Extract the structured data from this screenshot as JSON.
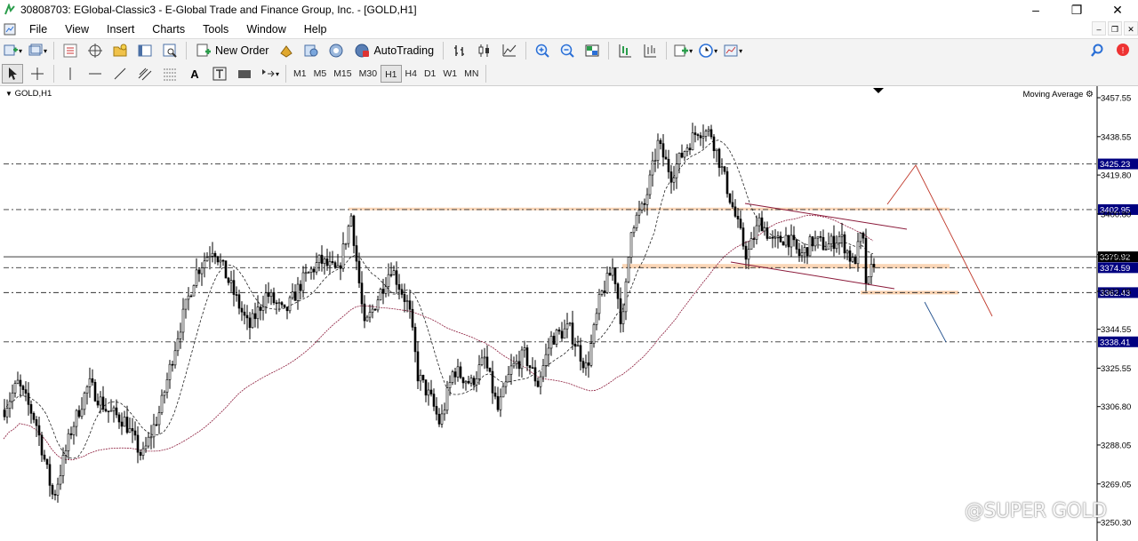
{
  "window": {
    "title": "30808703: EGlobal-Classic3 - E-Global Trade and Finance Group, Inc. - [GOLD,H1]"
  },
  "menu": [
    "File",
    "View",
    "Insert",
    "Charts",
    "Tools",
    "Window",
    "Help"
  ],
  "toolbar": {
    "new_order": "New Order",
    "autotrading": "AutoTrading"
  },
  "timeframes": [
    "M1",
    "M5",
    "M15",
    "M30",
    "H1",
    "H4",
    "D1",
    "W1",
    "MN"
  ],
  "active_timeframe": "H1",
  "chart": {
    "symbol_label": "GOLD,H1",
    "indicator_label": "Moving Average",
    "price_ticks": [
      "3457.55",
      "3438.55",
      "3419.80",
      "3400.80",
      "3381.05",
      "3363.05",
      "3344.55",
      "3325.55",
      "3306.80",
      "3288.05",
      "3269.05",
      "3250.30"
    ],
    "levels": [
      {
        "price": "3425.23",
        "style": "highlight"
      },
      {
        "price": "3402.95",
        "style": "highlight"
      },
      {
        "price": "3379.92",
        "style": "current"
      },
      {
        "price": "3374.59",
        "style": "highlight"
      },
      {
        "price": "3362.43",
        "style": "highlight"
      },
      {
        "price": "3338.41",
        "style": "highlight"
      }
    ],
    "colors": {
      "candle": "#000000",
      "level_label_bg": "#000080",
      "zone": "#f4a460",
      "trend": "#8b1a3a"
    }
  },
  "watermark": "@SUPER GOLD"
}
